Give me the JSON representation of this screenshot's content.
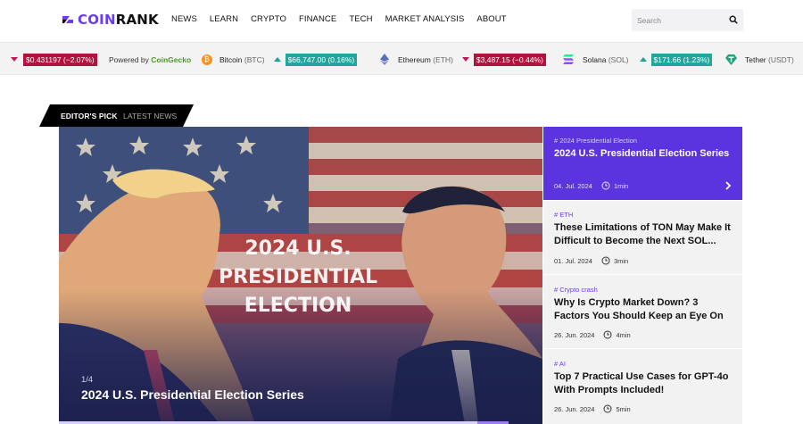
{
  "header": {
    "logo_coin": "COIN",
    "logo_rank": "RANK",
    "nav": [
      "NEWS",
      "LEARN",
      "CRYPTO",
      "FINANCE",
      "TECH",
      "MARKET ANALYSIS",
      "ABOUT"
    ],
    "search_placeholder": "Search"
  },
  "ticker": {
    "first_change": "$0.431197 (−2.07%)",
    "powered_prefix": "Powered by",
    "powered_brand": "CoinGecko",
    "coins": [
      {
        "name": "Bitcoin",
        "symbol": "(BTC)",
        "change": "$66,747.00 (0.16%)",
        "direction": "up",
        "color": "#f7931a"
      },
      {
        "name": "Ethereum",
        "symbol": "(ETH)",
        "change": "$3,487.15 (−0.44%)",
        "direction": "down",
        "color": "#5c6bc0"
      },
      {
        "name": "Solana",
        "symbol": "(SOL)",
        "change": "$171.66 (1.23%)",
        "direction": "up",
        "color": "#9945ff"
      },
      {
        "name": "Tether",
        "symbol": "(USDT)",
        "change": "",
        "direction": "",
        "color": "#26a17b"
      }
    ]
  },
  "tabs": {
    "active": "EDITOR'S PICK",
    "inactive": "LATEST NEWS"
  },
  "hero": {
    "image_text": [
      "2024 U.S.",
      "PRESIDENTIAL",
      "ELECTION"
    ],
    "counter": "1/4",
    "title": "2024 U.S. Presidential Election Series",
    "progress": 0.93
  },
  "articles": [
    {
      "tag": "# 2024 Presidential Election",
      "title": "2024 U.S. Presidential Election Series",
      "date": "04. Jul. 2024",
      "read": "1min",
      "active": true
    },
    {
      "tag": "# ETH",
      "title": "These Limitations of TON May Make It Difficult to Become the Next SOL...",
      "date": "01. Jul. 2024",
      "read": "3min",
      "active": false
    },
    {
      "tag": "# Crypto crash",
      "title": "Why Is Crypto Market Down? 3 Factors You Should Keep an Eye On",
      "date": "26. Jun. 2024",
      "read": "4min",
      "active": false
    },
    {
      "tag": "# AI",
      "title": "Top 7 Practical Use Cases for GPT-4o With Prompts Included!",
      "date": "26. Jun. 2024",
      "read": "5min",
      "active": false
    }
  ],
  "colors": {
    "brand": "#6b3cf0",
    "up": "#20a69d",
    "down": "#b3123f",
    "active_card": "#5b34e0"
  }
}
